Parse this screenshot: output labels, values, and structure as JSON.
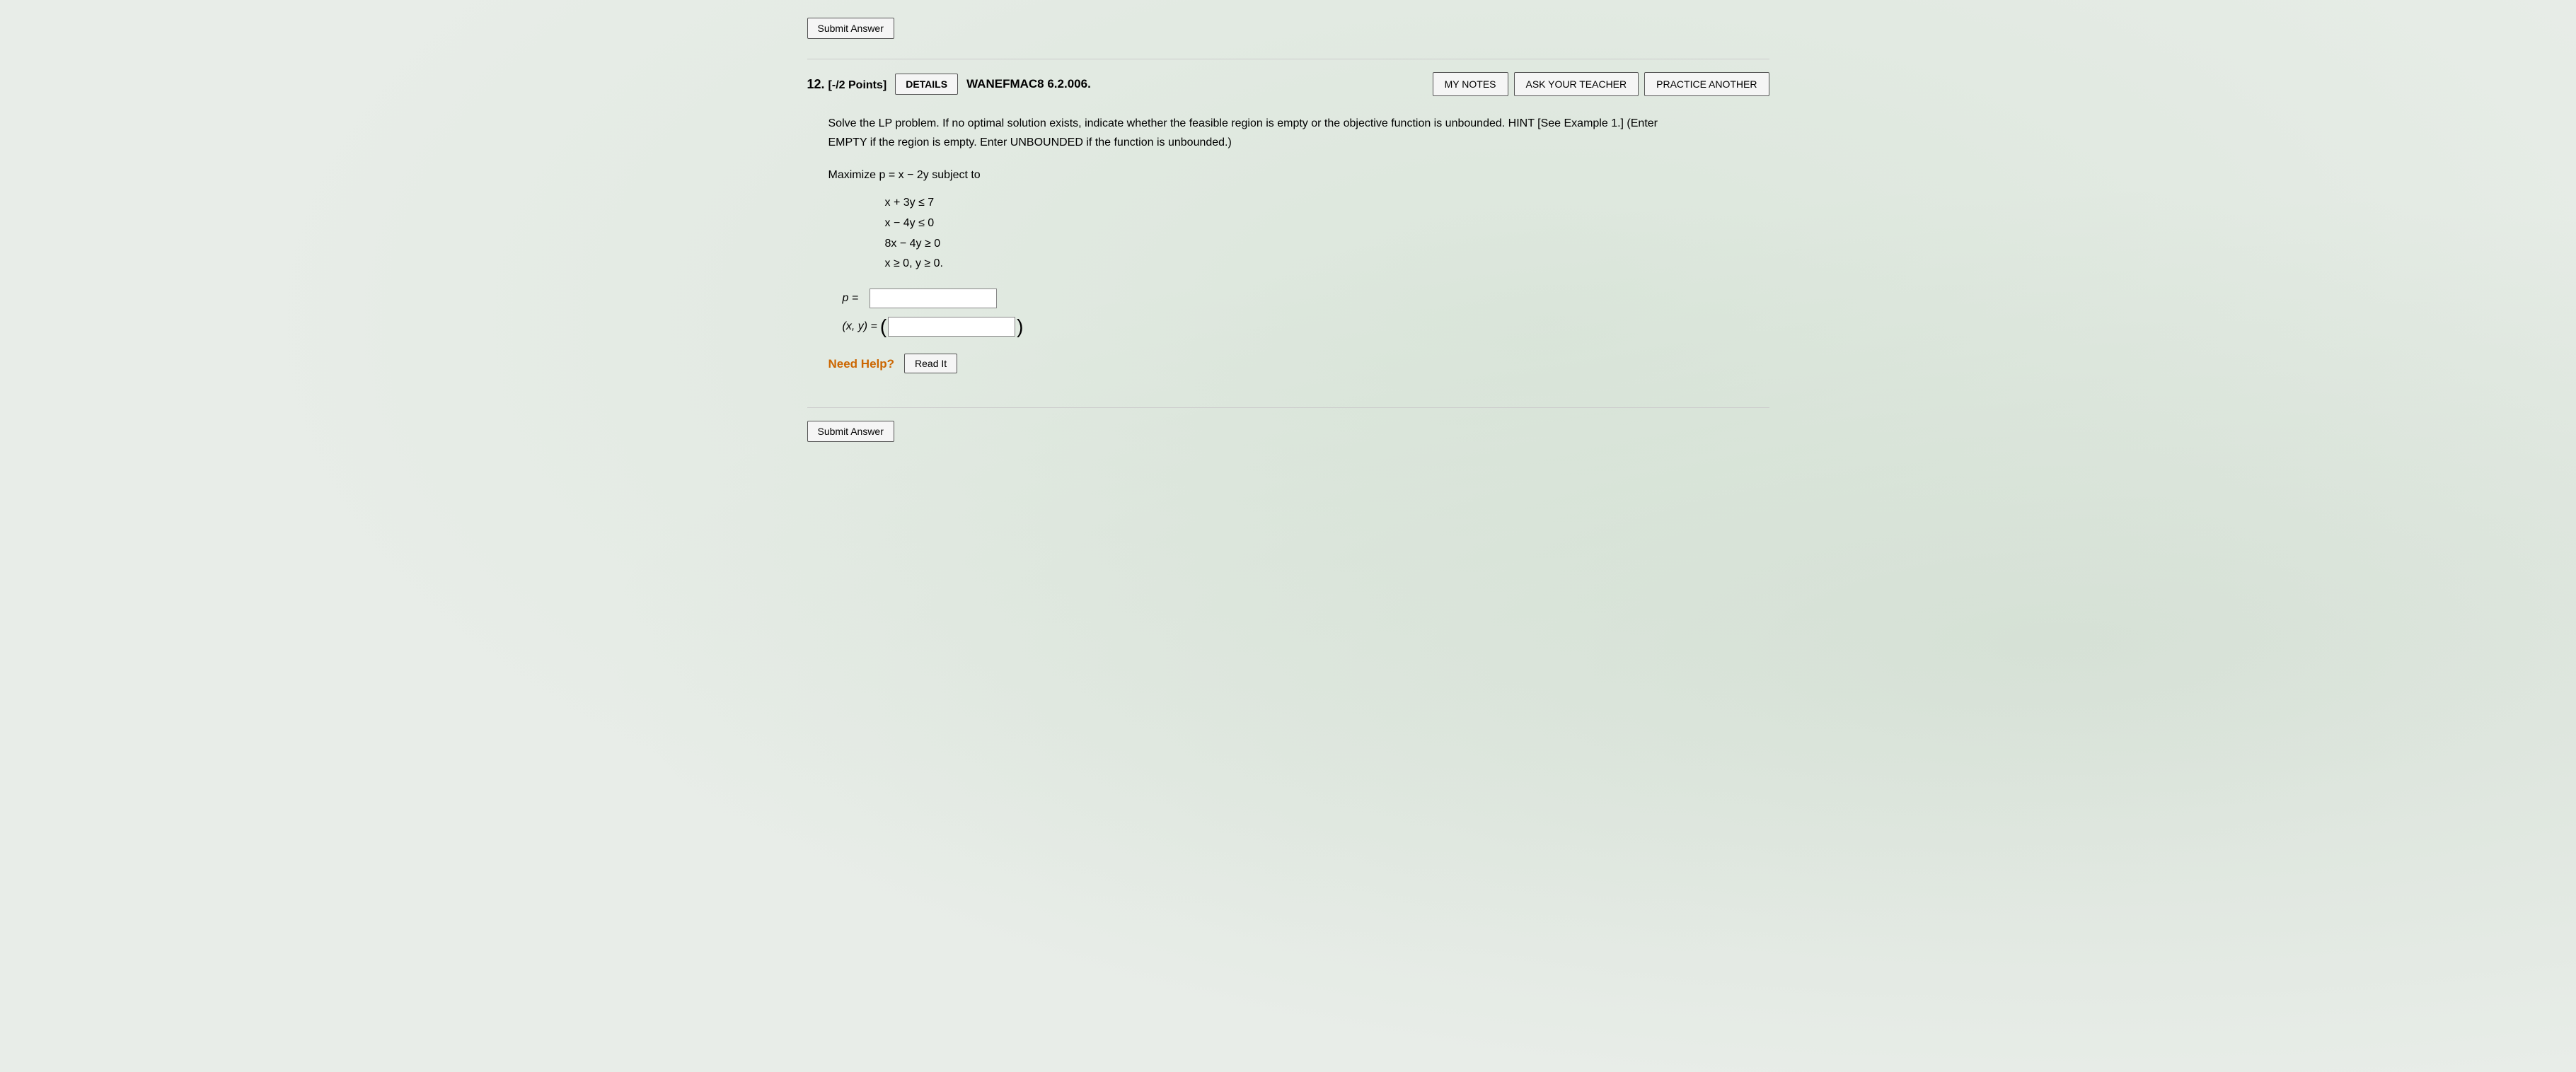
{
  "top_submit": {
    "label": "Submit Answer"
  },
  "question": {
    "number": "12.",
    "points": "[-/2 Points]",
    "details_label": "DETAILS",
    "problem_code": "WANEFMAC8 6.2.006.",
    "my_notes_label": "MY NOTES",
    "ask_teacher_label": "ASK YOUR TEACHER",
    "practice_another_label": "PRACTICE ANOTHER",
    "description_line1": "Solve the LP problem. If no optimal solution exists, indicate whether the feasible region is empty or the objective function is unbounded. HINT [See Example 1.] (Enter",
    "description_line2": "EMPTY if the region is empty. Enter UNBOUNDED if the function is unbounded.)",
    "maximize_label": "Maximize p = x − 2y subject to",
    "constraints": [
      "x + 3y ≤ 7",
      "x − 4y ≤ 0",
      "8x − 4y ≥ 0",
      "x ≥ 0, y ≥ 0."
    ],
    "p_label": "p =",
    "xy_label": "(x, y) =",
    "p_value": "",
    "xy_value": "",
    "need_help_text": "Need Help?",
    "read_it_label": "Read It"
  },
  "bottom_submit": {
    "label": "Submit Answer"
  }
}
